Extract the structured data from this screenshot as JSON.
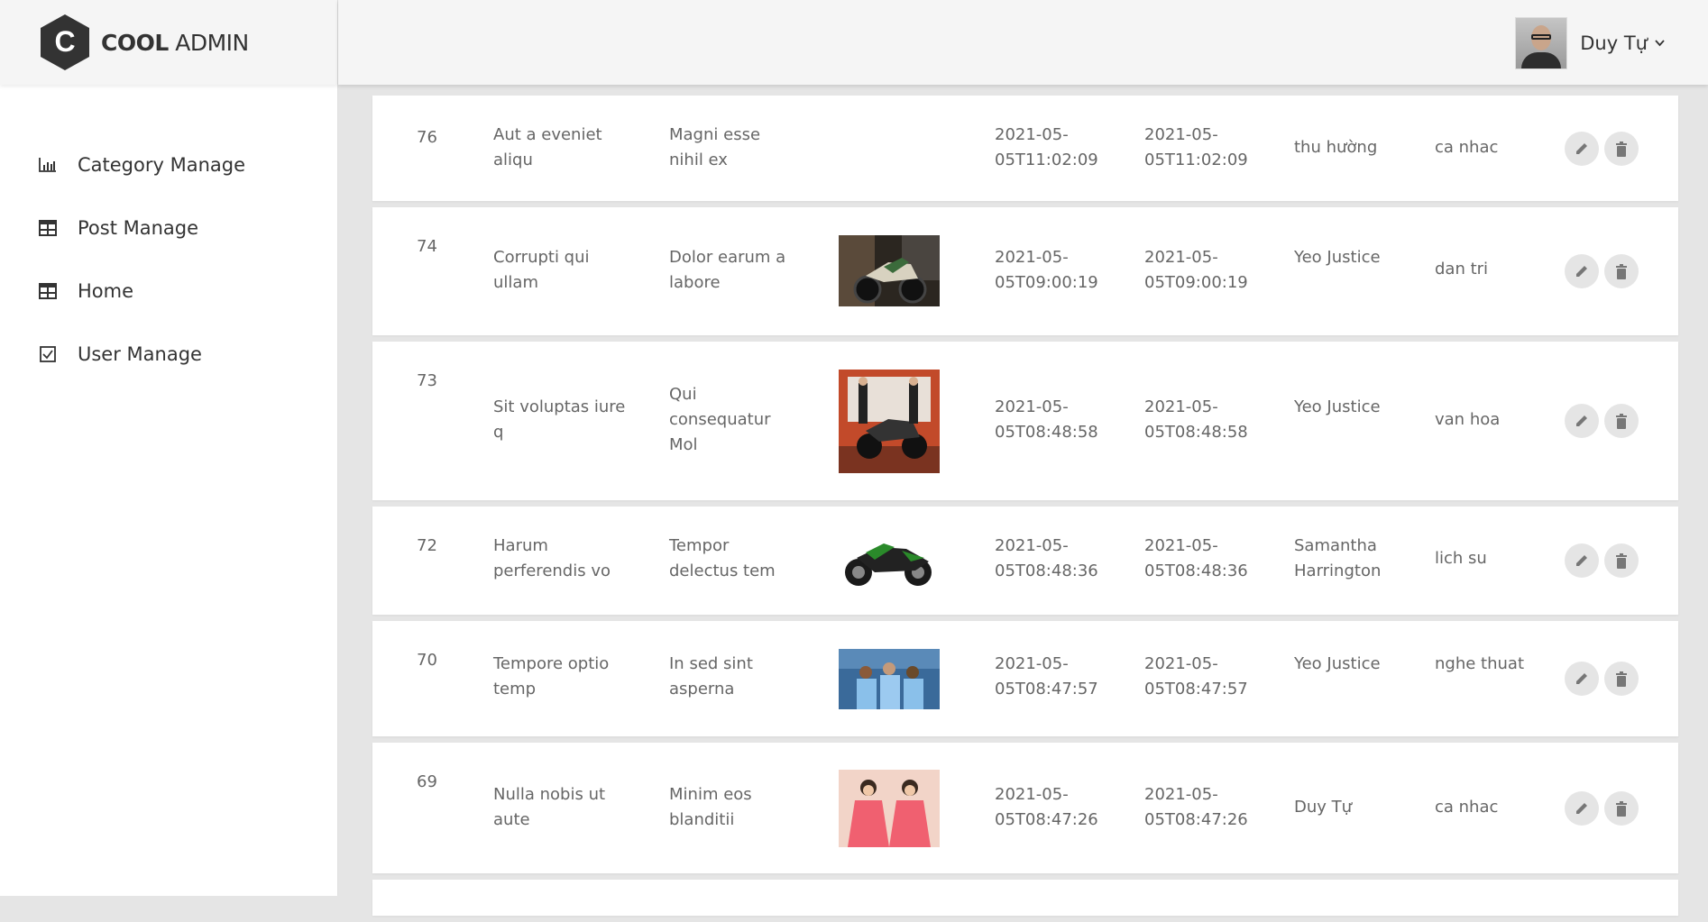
{
  "brand": {
    "logo_letter": "C",
    "name_bold": "COOL",
    "name_light": "ADMIN"
  },
  "sidebar": {
    "items": [
      {
        "label": "Category Manage",
        "icon": "bar-chart-icon"
      },
      {
        "label": "Post Manage",
        "icon": "table-icon"
      },
      {
        "label": "Home",
        "icon": "table-icon"
      },
      {
        "label": "User Manage",
        "icon": "checkbox-icon"
      }
    ]
  },
  "header": {
    "user_name": "Duy Tự"
  },
  "posts": [
    {
      "id": "76",
      "title": "Aut a eveniet aliqu",
      "desc": "Magni esse nihil ex",
      "image": "",
      "created": "2021-05-05T11:02:09",
      "updated": "2021-05-05T11:02:09",
      "author": "thu hường",
      "category": "ca nhac"
    },
    {
      "id": "74",
      "title": "Corrupti qui ullam",
      "desc": "Dolor earum a labore",
      "image": "motorbike-adventure-photo",
      "created": "2021-05-05T09:00:19",
      "updated": "2021-05-05T09:00:19",
      "author": "Yeo Justice",
      "category": "dan tri"
    },
    {
      "id": "73",
      "title": "Sit voluptas iure q",
      "desc": "Qui consequatur Mol",
      "image": "motorbike-models-photo",
      "created": "2021-05-05T08:48:58",
      "updated": "2021-05-05T08:48:58",
      "author": "Yeo Justice",
      "category": "van hoa"
    },
    {
      "id": "72",
      "title": "Harum perferendis vo",
      "desc": "Tempor delectus tem",
      "image": "sport-bike-photo",
      "created": "2021-05-05T08:48:36",
      "updated": "2021-05-05T08:48:36",
      "author": "Samantha Harrington",
      "category": "lich su"
    },
    {
      "id": "70",
      "title": "Tempore optio temp",
      "desc": "In sed sint asperna",
      "image": "football-team-photo",
      "created": "2021-05-05T08:47:57",
      "updated": "2021-05-05T08:47:57",
      "author": "Yeo Justice",
      "category": "nghe thuat"
    },
    {
      "id": "69",
      "title": "Nulla nobis ut aute",
      "desc": "Minim eos blanditii",
      "image": "girls-dresses-photo",
      "created": "2021-05-05T08:47:26",
      "updated": "2021-05-05T08:47:26",
      "author": "Duy Tự",
      "category": "ca nhac"
    }
  ],
  "colors": {
    "sidebar_bg": "#ffffff",
    "header_bg": "#f5f5f5",
    "page_bg": "#e5e5e5",
    "text": "#666666",
    "action_bg": "#e5e5e5"
  }
}
